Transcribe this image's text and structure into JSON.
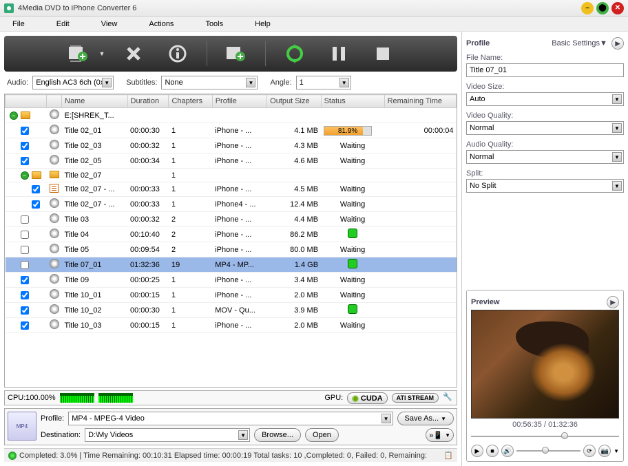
{
  "window": {
    "title": "4Media DVD to iPhone Converter 6"
  },
  "menu": [
    "File",
    "Edit",
    "View",
    "Actions",
    "Tools",
    "Help"
  ],
  "filters": {
    "audio_label": "Audio:",
    "audio_value": "English AC3 6ch (0x8",
    "subtitles_label": "Subtitles:",
    "subtitles_value": "None",
    "angle_label": "Angle:",
    "angle_value": "1"
  },
  "columns": [
    "",
    "",
    "Name",
    "Duration",
    "Chapters",
    "Profile",
    "Output Size",
    "Status",
    "Remaining Time"
  ],
  "rows": [
    {
      "type": "root",
      "checked": true,
      "name": "E:[SHREK_T...",
      "duration": "",
      "chapters": "",
      "profile": "",
      "size": "",
      "status": "",
      "remain": "",
      "icon": "disc"
    },
    {
      "type": "item",
      "indent": 1,
      "checked": true,
      "name": "Title 02_01",
      "duration": "00:00:30",
      "chapters": "1",
      "profile": "iPhone - ...",
      "size": "4.1 MB",
      "status": "progress",
      "progress": 81.9,
      "remain": "00:00:04",
      "icon": "disc"
    },
    {
      "type": "item",
      "indent": 1,
      "checked": true,
      "name": "Title 02_03",
      "duration": "00:00:32",
      "chapters": "1",
      "profile": "iPhone - ...",
      "size": "4.3 MB",
      "status": "Waiting",
      "remain": "",
      "icon": "disc"
    },
    {
      "type": "item",
      "indent": 1,
      "checked": true,
      "name": "Title 02_05",
      "duration": "00:00:34",
      "chapters": "1",
      "profile": "iPhone - ...",
      "size": "4.6 MB",
      "status": "Waiting",
      "remain": "",
      "icon": "disc"
    },
    {
      "type": "folder",
      "indent": 1,
      "checked": false,
      "name": "Title 02_07",
      "duration": "",
      "chapters": "1",
      "profile": "",
      "size": "",
      "status": "",
      "remain": "",
      "icon": "folder"
    },
    {
      "type": "item",
      "indent": 2,
      "checked": true,
      "name": "Title 02_07 - ...",
      "duration": "00:00:33",
      "chapters": "1",
      "profile": "iPhone - ...",
      "size": "4.5 MB",
      "status": "Waiting",
      "remain": "",
      "icon": "list"
    },
    {
      "type": "item",
      "indent": 2,
      "checked": true,
      "name": "Title 02_07 - ...",
      "duration": "00:00:33",
      "chapters": "1",
      "profile": "iPhone4 - ...",
      "size": "12.4 MB",
      "status": "Waiting",
      "remain": "",
      "icon": "disc"
    },
    {
      "type": "item",
      "indent": 1,
      "checked": false,
      "name": "Title 03",
      "duration": "00:00:32",
      "chapters": "2",
      "profile": "iPhone - ...",
      "size": "4.4 MB",
      "status": "Waiting",
      "remain": "",
      "icon": "disc"
    },
    {
      "type": "item",
      "indent": 1,
      "checked": false,
      "name": "Title 04",
      "duration": "00:10:40",
      "chapters": "2",
      "profile": "iPhone - ...",
      "size": "86.2 MB",
      "status": "ready",
      "remain": "",
      "icon": "disc"
    },
    {
      "type": "item",
      "indent": 1,
      "checked": false,
      "name": "Title 05",
      "duration": "00:09:54",
      "chapters": "2",
      "profile": "iPhone - ...",
      "size": "80.0 MB",
      "status": "Waiting",
      "remain": "",
      "icon": "disc"
    },
    {
      "type": "item",
      "indent": 1,
      "checked": false,
      "name": "Title 07_01",
      "duration": "01:32:36",
      "chapters": "19",
      "profile": "MP4 - MP...",
      "size": "1.4 GB",
      "status": "ready",
      "remain": "",
      "icon": "disc",
      "selected": true
    },
    {
      "type": "item",
      "indent": 1,
      "checked": true,
      "name": "Title 09",
      "duration": "00:00:25",
      "chapters": "1",
      "profile": "iPhone - ...",
      "size": "3.4 MB",
      "status": "Waiting",
      "remain": "",
      "icon": "disc"
    },
    {
      "type": "item",
      "indent": 1,
      "checked": true,
      "name": "Title 10_01",
      "duration": "00:00:15",
      "chapters": "1",
      "profile": "iPhone - ...",
      "size": "2.0 MB",
      "status": "Waiting",
      "remain": "",
      "icon": "disc"
    },
    {
      "type": "item",
      "indent": 1,
      "checked": true,
      "name": "Title 10_02",
      "duration": "00:00:30",
      "chapters": "1",
      "profile": "MOV - Qu...",
      "size": "3.9 MB",
      "status": "ready",
      "remain": "",
      "icon": "disc"
    },
    {
      "type": "item",
      "indent": 1,
      "checked": true,
      "name": "Title 10_03",
      "duration": "00:00:15",
      "chapters": "1",
      "profile": "iPhone - ...",
      "size": "2.0 MB",
      "status": "Waiting",
      "remain": "",
      "icon": "disc"
    }
  ],
  "cpu": {
    "label": "CPU:100.00%",
    "gpu_label": "GPU:",
    "cuda": "CUDA",
    "ati": "ATI STREAM"
  },
  "bottom": {
    "profile_label": "Profile:",
    "profile_value": "MP4 - MPEG-4 Video",
    "saveas": "Save As...",
    "dest_label": "Destination:",
    "dest_value": "D:\\My Videos",
    "browse": "Browse...",
    "open": "Open"
  },
  "status": {
    "text": "Completed: 3.0% | Time Remaining: 00:10:31 Elapsed time: 00:00:19 Total tasks: 10 ,Completed: 0, Failed: 0, Remaining:"
  },
  "profile_panel": {
    "title": "Profile",
    "basic": "Basic Settings",
    "filename_label": "File Name:",
    "filename": "Title 07_01",
    "videosize_label": "Video Size:",
    "videosize": "Auto",
    "videoquality_label": "Video Quality:",
    "videoquality": "Normal",
    "audioquality_label": "Audio Quality:",
    "audioquality": "Normal",
    "split_label": "Split:",
    "split": "No Split"
  },
  "preview": {
    "title": "Preview",
    "time": "00:56:35 / 01:32:36"
  }
}
